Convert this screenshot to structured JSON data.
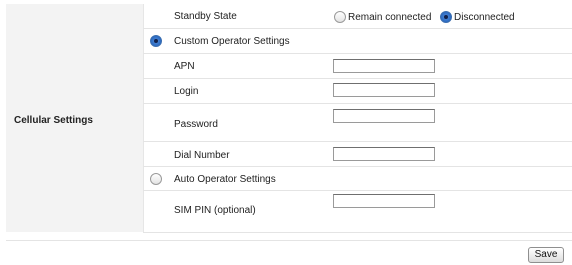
{
  "section": {
    "label": "Cellular Settings"
  },
  "standby": {
    "label": "Standby State",
    "options": [
      {
        "label": "Remain connected",
        "selected": false
      },
      {
        "label": "Disconnected",
        "selected": true
      }
    ]
  },
  "custom_operator": {
    "label": "Custom Operator Settings",
    "selected": true
  },
  "fields": {
    "apn": {
      "label": "APN",
      "value": ""
    },
    "login": {
      "label": "Login",
      "value": ""
    },
    "password": {
      "label": "Password",
      "value": ""
    },
    "dial_number": {
      "label": "Dial Number",
      "value": ""
    }
  },
  "auto_operator": {
    "label": "Auto Operator Settings",
    "selected": false
  },
  "sim_pin": {
    "label": "SIM PIN (optional)",
    "value": ""
  },
  "footer": {
    "save_label": "Save"
  }
}
